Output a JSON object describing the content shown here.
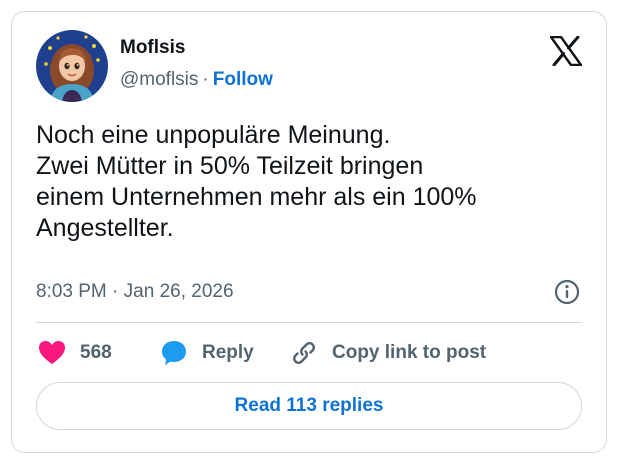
{
  "author": {
    "display_name": "Moflsis",
    "handle": "@moflsis",
    "separator": "·",
    "follow_label": "Follow",
    "avatar_icon": "cartoon-girl-avatar-icon"
  },
  "brand": {
    "logo_icon": "x-logo-icon"
  },
  "tweet": {
    "lines": [
      "Noch eine unpopuläre Meinung.",
      "Zwei Mütter in 50% Teilzeit bringen",
      "einem Unternehmen mehr als ein 100%",
      "Angestellter."
    ],
    "time": "8:03 PM",
    "separator": "·",
    "date": "Jan 26, 2026"
  },
  "actions": {
    "like_count": "568",
    "reply_label": "Reply",
    "copy_label": "Copy link to post"
  },
  "footer": {
    "read_replies_label": "Read 113 replies"
  },
  "colors": {
    "link_blue": "#0f73d6",
    "like_pink": "#f91880",
    "reply_blue": "#1d9bf0",
    "text_dark": "#0f1419",
    "text_gray": "#536471",
    "border": "#cfd9de"
  }
}
